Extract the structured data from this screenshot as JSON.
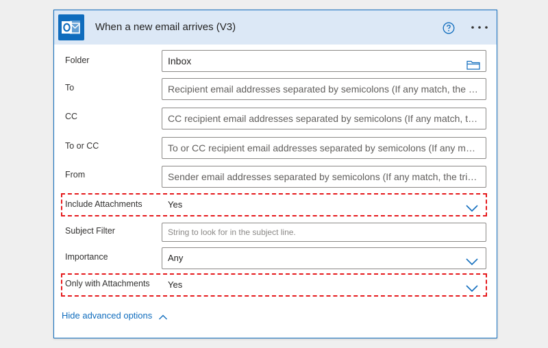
{
  "header": {
    "title": "When a new email arrives (V3)",
    "logo_icon": "outlook-logo-icon",
    "help_icon": "help-icon",
    "more_icon": "more-options-icon"
  },
  "fields": {
    "folder": {
      "label": "Folder",
      "value": "Inbox"
    },
    "to": {
      "label": "To",
      "placeholder": "Recipient email addresses separated by semicolons (If any match, the trigger will run)"
    },
    "cc": {
      "label": "CC",
      "placeholder": "CC recipient email addresses separated by semicolons (If any match, the trigger will run)"
    },
    "to_or_cc": {
      "label": "To or CC",
      "placeholder": "To or CC recipient email addresses separated by semicolons (If any match, the trigger will run)"
    },
    "from": {
      "label": "From",
      "placeholder": "Sender email addresses separated by semicolons (If any match, the trigger will run)"
    },
    "include_attachments": {
      "label": "Include Attachments",
      "value": "Yes"
    },
    "subject_filter": {
      "label": "Subject Filter",
      "placeholder": "String to look for in the subject line."
    },
    "importance": {
      "label": "Importance",
      "value": "Any"
    },
    "only_with_attachments": {
      "label": "Only with Attachments",
      "value": "Yes"
    }
  },
  "footer": {
    "toggle_label": "Hide advanced options"
  },
  "colors": {
    "accent": "#0f6cbd",
    "highlight": "#e5181b",
    "header_bg": "#dce8f6"
  }
}
